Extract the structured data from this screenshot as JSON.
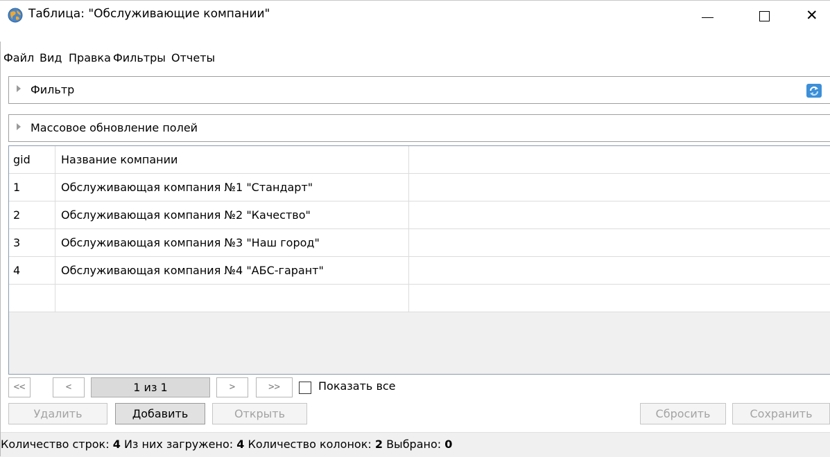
{
  "window": {
    "title": "Таблица: \"Обслуживающие компании\"",
    "controls": {
      "minimize": "—",
      "maximize": "□",
      "close": "✕"
    }
  },
  "menu": [
    "Файл",
    "Вид",
    "Правка",
    "Фильтры",
    "Отчеты"
  ],
  "filter_panel": {
    "label": "Фильтр",
    "icon": "refresh-icon"
  },
  "mass_update_panel": {
    "label": "Массовое обновление полей"
  },
  "grid": {
    "columns": [
      "gid",
      "Название компании"
    ],
    "rows": [
      [
        "1",
        "Обслуживающая компания №1 \"Стандарт\""
      ],
      [
        "2",
        "Обслуживающая компания №2 \"Качество\""
      ],
      [
        "3",
        "Обслуживающая компания №3 \"Наш город\""
      ],
      [
        "4",
        "Обслуживающая компания №4 \"АБС-гарант\""
      ]
    ]
  },
  "pager": {
    "first": "<<",
    "prev": "<",
    "page_info": "1 из 1",
    "next": ">",
    "last": ">>",
    "show_all_label": "Показать все",
    "show_all_checked": false
  },
  "actions": {
    "delete": "Удалить",
    "add": "Добавить",
    "open": "Открыть",
    "reset": "Сбросить",
    "save": "Сохранить"
  },
  "status": {
    "rows_label": "Количество строк:",
    "rows_value": "4",
    "loaded_label": "Из них загружено:",
    "loaded_value": "4",
    "cols_label": "Количество колонок:",
    "cols_value": "2",
    "selected_label": "Выбрано:",
    "selected_value": "0"
  }
}
